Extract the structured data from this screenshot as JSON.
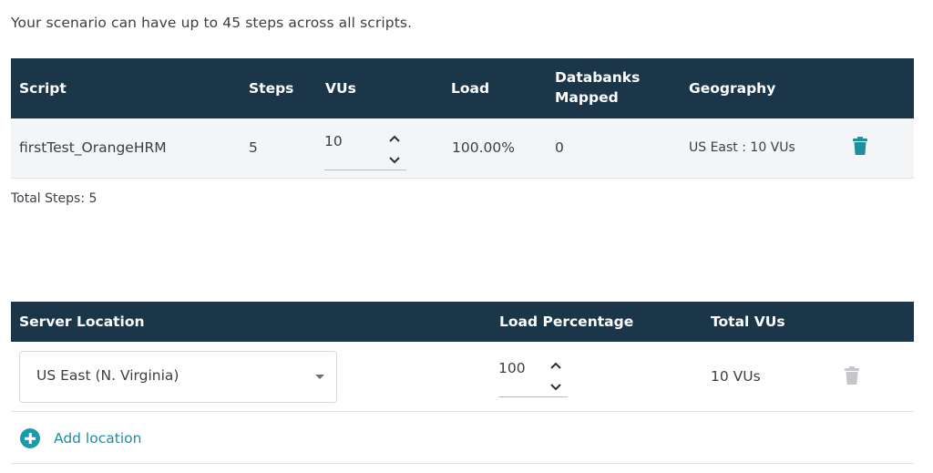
{
  "intro_text": "Your scenario can have up to 45 steps across all scripts.",
  "scripts_table": {
    "headers": {
      "script": "Script",
      "steps": "Steps",
      "vus": "VUs",
      "load": "Load",
      "databanks_line1": "Databanks",
      "databanks_line2": "Mapped",
      "geography": "Geography"
    },
    "rows": [
      {
        "script": "firstTest_OrangeHRM",
        "steps": "5",
        "vus": "10",
        "load": "100.00%",
        "databanks": "0",
        "geography": "US East : 10 VUs"
      }
    ]
  },
  "total_steps": "Total Steps: 5",
  "locations_table": {
    "headers": {
      "server_location": "Server Location",
      "load_percentage": "Load Percentage",
      "total_vus": "Total VUs"
    },
    "rows": [
      {
        "server_location": "US East (N. Virginia)",
        "load_percentage": "100",
        "total_vus": "10 VUs"
      }
    ]
  },
  "add_location_label": "Add location",
  "colors": {
    "header_bg": "#1b3649",
    "accent": "#1b9aaa",
    "trash_active": "#1f8f9c",
    "trash_disabled": "#c4c6c9"
  }
}
